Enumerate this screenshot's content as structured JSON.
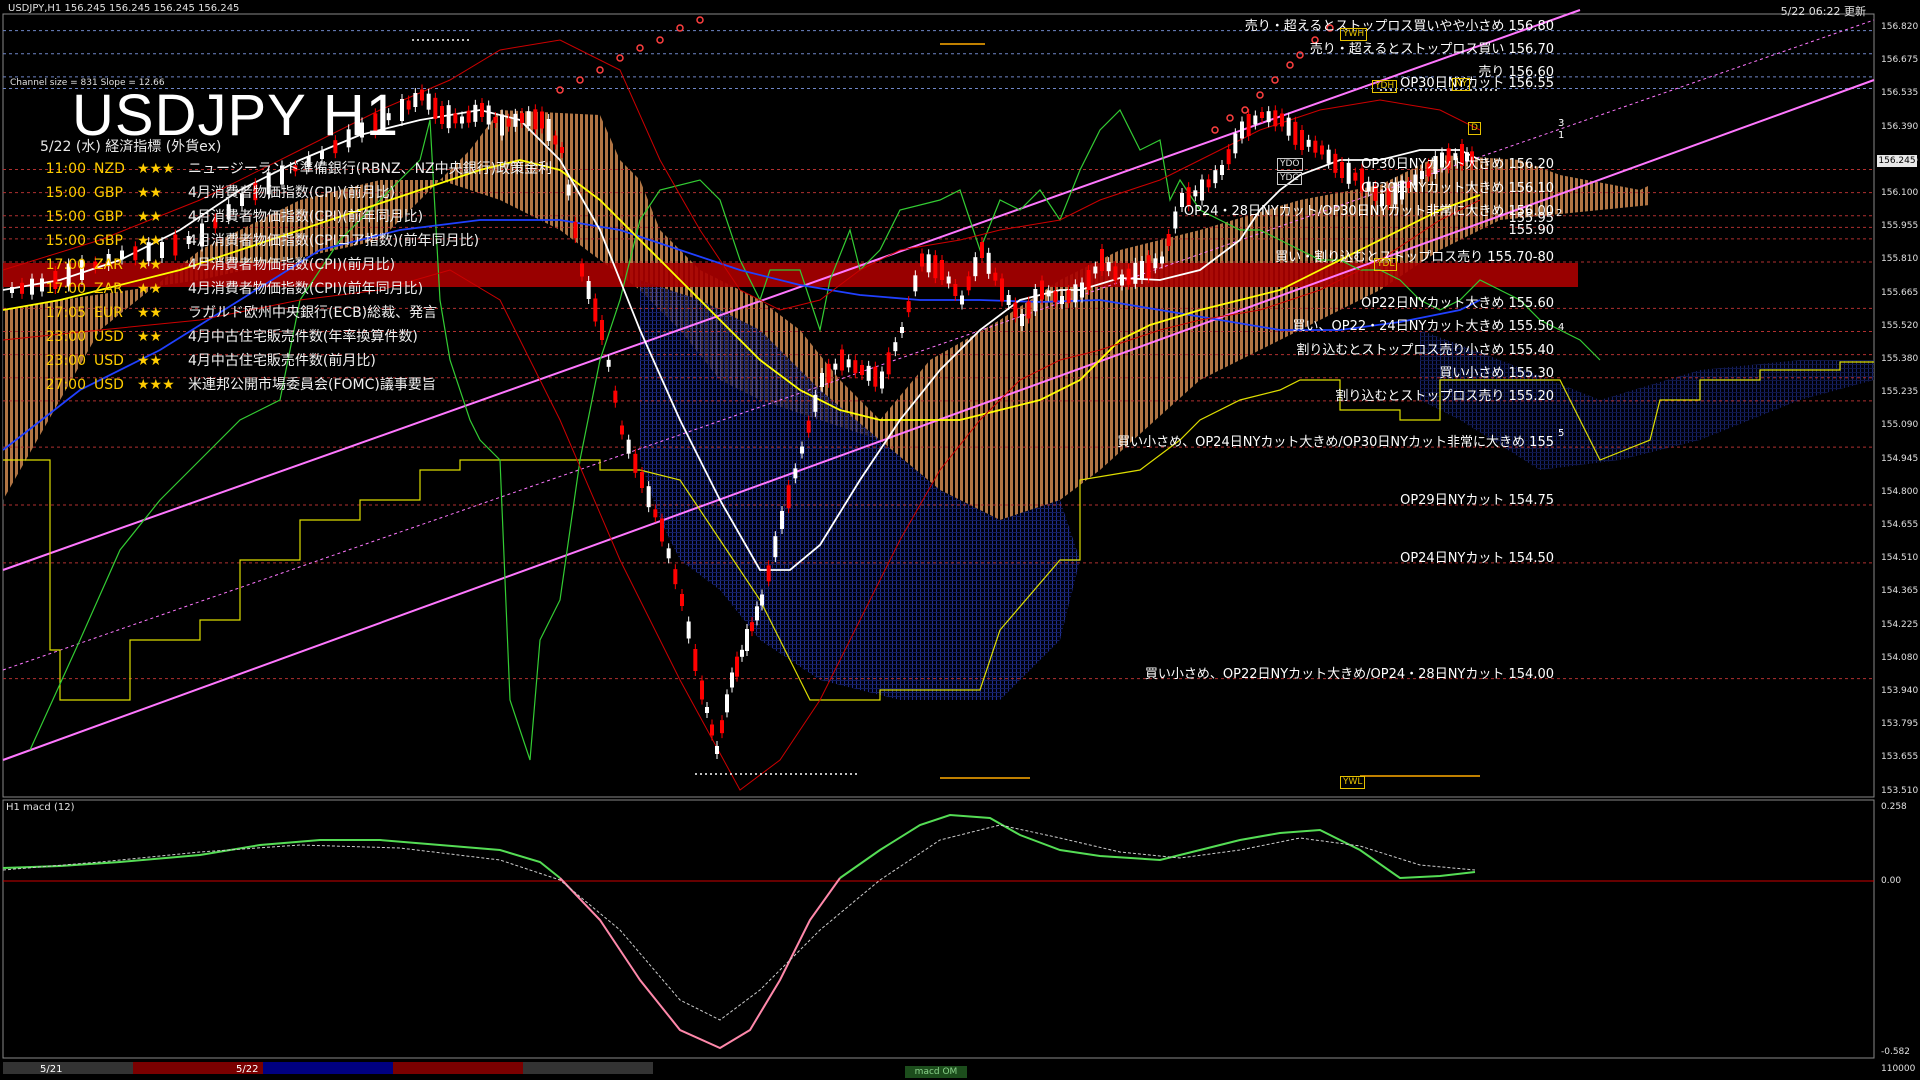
{
  "header": {
    "symbol_info": "USDJPY,H1  156.245 156.245 156.245 156.245",
    "updated": "5/22 06:22 更新",
    "title": "USDJPY H1",
    "subtitle": "5/22 (水) 経済指標 (外貨ex)",
    "channel_info": "Channel size = 831 Slope = 12.66"
  },
  "events": [
    {
      "time": "11:00",
      "country": "NZD",
      "stars": "★★★",
      "name": "ニュージーランド準備銀行(RBNZ、NZ中央銀行)政策金利"
    },
    {
      "time": "15:00",
      "country": "GBP",
      "stars": "★★",
      "name": "4月消費者物価指数(CPI)(前月比)"
    },
    {
      "time": "15:00",
      "country": "GBP",
      "stars": "★★",
      "name": "4月消費者物価指数(CPI)(前年同月比)"
    },
    {
      "time": "15:00",
      "country": "GBP",
      "stars": "★★",
      "name": "4月消費者物価指数(CPIコア指数)(前年同月比)"
    },
    {
      "time": "17:00",
      "country": "ZAR",
      "stars": "★★",
      "name": "4月消費者物価指数(CPI)(前月比)"
    },
    {
      "time": "17:00",
      "country": "ZAR",
      "stars": "★★",
      "name": "4月消費者物価指数(CPI)(前年同月比)"
    },
    {
      "time": "17:05",
      "country": "EUR",
      "stars": "★★",
      "name": "ラガルド欧州中央銀行(ECB)総裁、発言"
    },
    {
      "time": "23:00",
      "country": "USD",
      "stars": "★★",
      "name": "4月中古住宅販売件数(年率換算件数)"
    },
    {
      "time": "23:00",
      "country": "USD",
      "stars": "★★",
      "name": "4月中古住宅販売件数(前月比)"
    },
    {
      "time": "27:00",
      "country": "USD",
      "stars": "★★★",
      "name": "米連邦公開市場委員会(FOMC)議事要旨"
    }
  ],
  "levels": [
    {
      "price": 156.8,
      "text": "売り・超えるとストップロス買いやや小さめ 156.80"
    },
    {
      "price": 156.7,
      "text": "売り・超えるとストップロス買い 156.70"
    },
    {
      "price": 156.6,
      "text": "売り 156.60"
    },
    {
      "price": 156.55,
      "text": "OP30日NYカット 156.55"
    },
    {
      "price": 156.2,
      "text": "OP30日NYカット大きめ 156.20"
    },
    {
      "price": 156.1,
      "text": "OP30日NYカット大きめ 156.10"
    },
    {
      "price": 156.0,
      "text": "OP24・28日NYカット/OP30日NYカット非常に大きめ 156.00"
    },
    {
      "price": 155.95,
      "text": "155.95"
    },
    {
      "price": 155.9,
      "text": "155.90"
    },
    {
      "price": 155.8,
      "text": "買い・割り込むとストップロス売り 155.70-80"
    },
    {
      "price": 155.6,
      "text": "OP22日NYカット大きめ 155.60"
    },
    {
      "price": 155.5,
      "text": "買い、OP22・24日NYカット大きめ 155.50"
    },
    {
      "price": 155.4,
      "text": "割り込むとストップロス売り小さめ 155.40"
    },
    {
      "price": 155.3,
      "text": "買い小さめ 155.30"
    },
    {
      "price": 155.2,
      "text": "割り込むとストップロス売り 155.20"
    },
    {
      "price": 155.0,
      "text": "買い小さめ、OP24日NYカット大きめ/OP30日NYカット非常に大きめ 155"
    },
    {
      "price": 154.75,
      "text": "OP29日NYカット 154.75"
    },
    {
      "price": 154.5,
      "text": "OP24日NYカット 154.50"
    },
    {
      "price": 154.0,
      "text": "買い小さめ、OP22日NYカット大きめ/OP24・28日NYカット 154.00"
    }
  ],
  "price_axis": {
    "labels": [
      "156.820",
      "156.675",
      "156.535",
      "156.390",
      "156.245",
      "156.100",
      "155.955",
      "155.810",
      "155.665",
      "155.520",
      "155.380",
      "155.235",
      "155.090",
      "154.945",
      "154.800",
      "154.655",
      "154.510",
      "154.365",
      "154.225",
      "154.080",
      "153.940",
      "153.795",
      "153.655",
      "153.510"
    ],
    "current": "156.245"
  },
  "markers": {
    "ydh": "YDH",
    "yvh": "YWH",
    "nyh": "NY",
    "ydo": "YDO",
    "ydc": "YDC",
    "ydl": "YDL",
    "ywl": "YWL",
    "d": "D"
  },
  "waves": [
    "3",
    "1",
    "2",
    "4",
    "5"
  ],
  "macd": {
    "label": "H1  macd (12)",
    "axis_top": "0.258",
    "axis_zero": "0.00",
    "axis_bottom": "-0.582",
    "volume_label": "110000",
    "legend": "macd OM"
  },
  "dates": [
    "5/21",
    "5/22"
  ],
  "colors": {
    "bull": "#ffffff",
    "bear": "#ff0000",
    "cloud_up": "#ffb070",
    "cloud_dn": "#3a5cff",
    "channel": "#ff77ff",
    "ma_yellow": "#ffff00",
    "ma_white": "#ffffff",
    "ma_blue": "#2040ff",
    "macd": "#55dd55",
    "macd_neg": "#ff88aa"
  }
}
